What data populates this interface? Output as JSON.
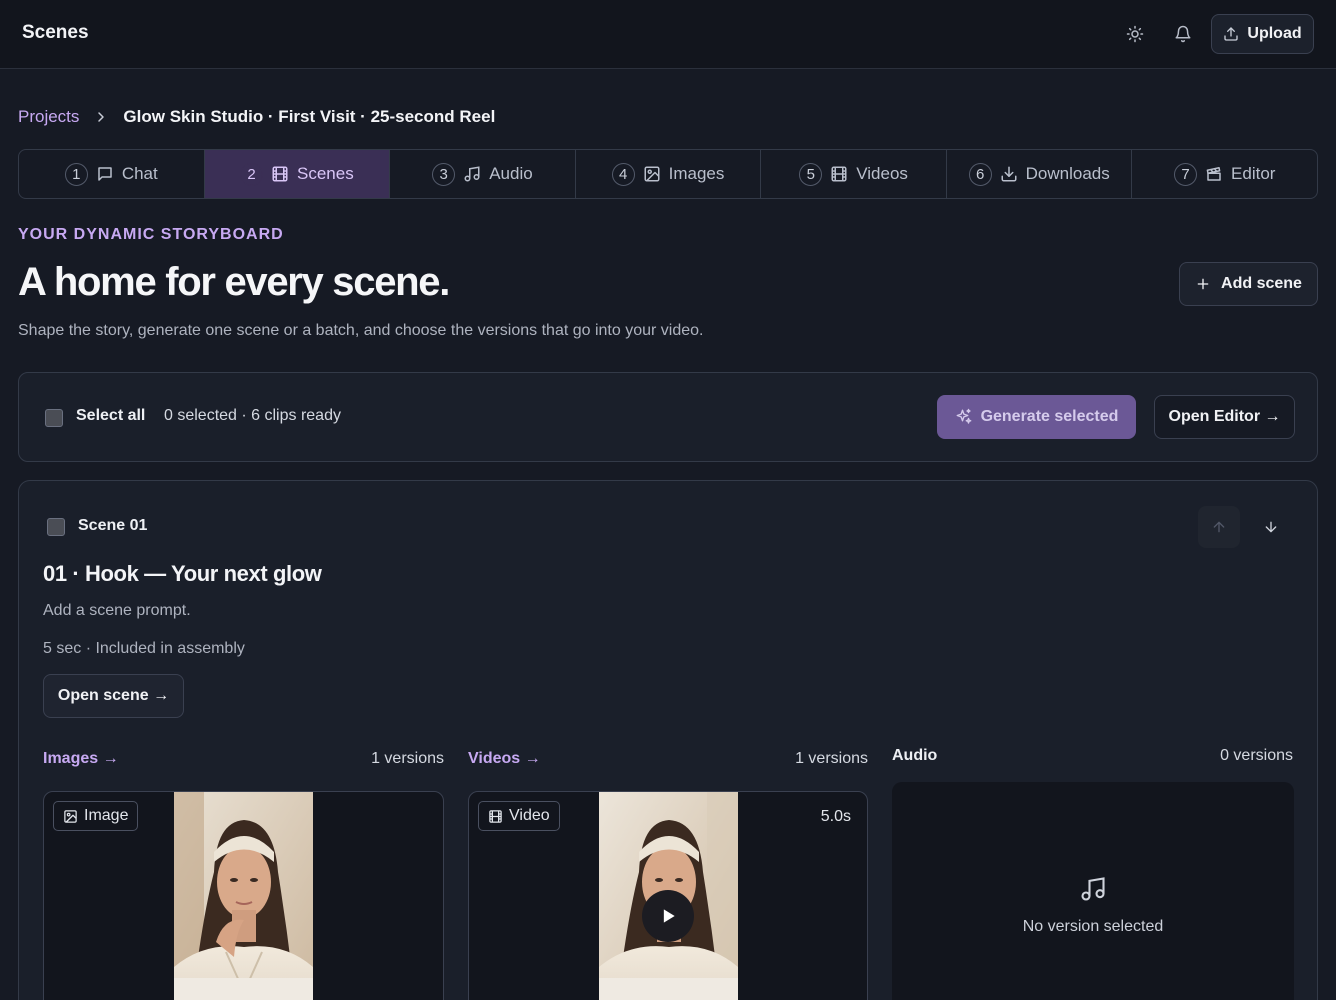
{
  "header": {
    "title": "Scenes",
    "theme_icon": "sun-icon",
    "notifications_icon": "bell-icon",
    "upload_label": "Upload"
  },
  "breadcrumb": {
    "parent": "Projects",
    "current": "Glow Skin Studio · First Visit · 25-second Reel"
  },
  "steps": [
    {
      "num": "1",
      "label": "Chat",
      "icon": "chat-icon",
      "active": false
    },
    {
      "num": "2",
      "label": "Scenes",
      "icon": "film-icon",
      "active": true
    },
    {
      "num": "3",
      "label": "Audio",
      "icon": "music-icon",
      "active": false
    },
    {
      "num": "4",
      "label": "Images",
      "icon": "image-icon",
      "active": false
    },
    {
      "num": "5",
      "label": "Videos",
      "icon": "film-icon",
      "active": false
    },
    {
      "num": "6",
      "label": "Downloads",
      "icon": "download-icon",
      "active": false
    },
    {
      "num": "7",
      "label": "Editor",
      "icon": "clapperboard-icon",
      "active": false
    }
  ],
  "intro": {
    "eyebrow": "YOUR DYNAMIC STORYBOARD",
    "title": "A home for every scene.",
    "subtitle": "Shape the story, generate one scene or a batch, and choose the versions that go into your video.",
    "add_scene_label": "Add scene"
  },
  "selection_bar": {
    "select_all_label": "Select all",
    "status": "0 selected · 6 clips ready",
    "generate_label": "Generate selected",
    "open_editor_label": "Open Editor →"
  },
  "scene": {
    "label": "Scene 01",
    "title": "01 · Hook — Your next glow",
    "prompt": "Add a scene prompt.",
    "meta": "5 sec · Included in assembly",
    "open_label": "Open scene →",
    "images": {
      "heading": "Images →",
      "count": "1 versions",
      "tag": "Image"
    },
    "videos": {
      "heading": "Videos →",
      "count": "1 versions",
      "tag": "Video",
      "duration": "5.0s"
    },
    "audio": {
      "heading": "Audio",
      "count": "0 versions",
      "empty": "No version selected"
    }
  },
  "colors": {
    "accent": "#c7a9f2",
    "background": "#161a24",
    "active_step": "#3a2f55",
    "generate_button": "#6b5896"
  }
}
